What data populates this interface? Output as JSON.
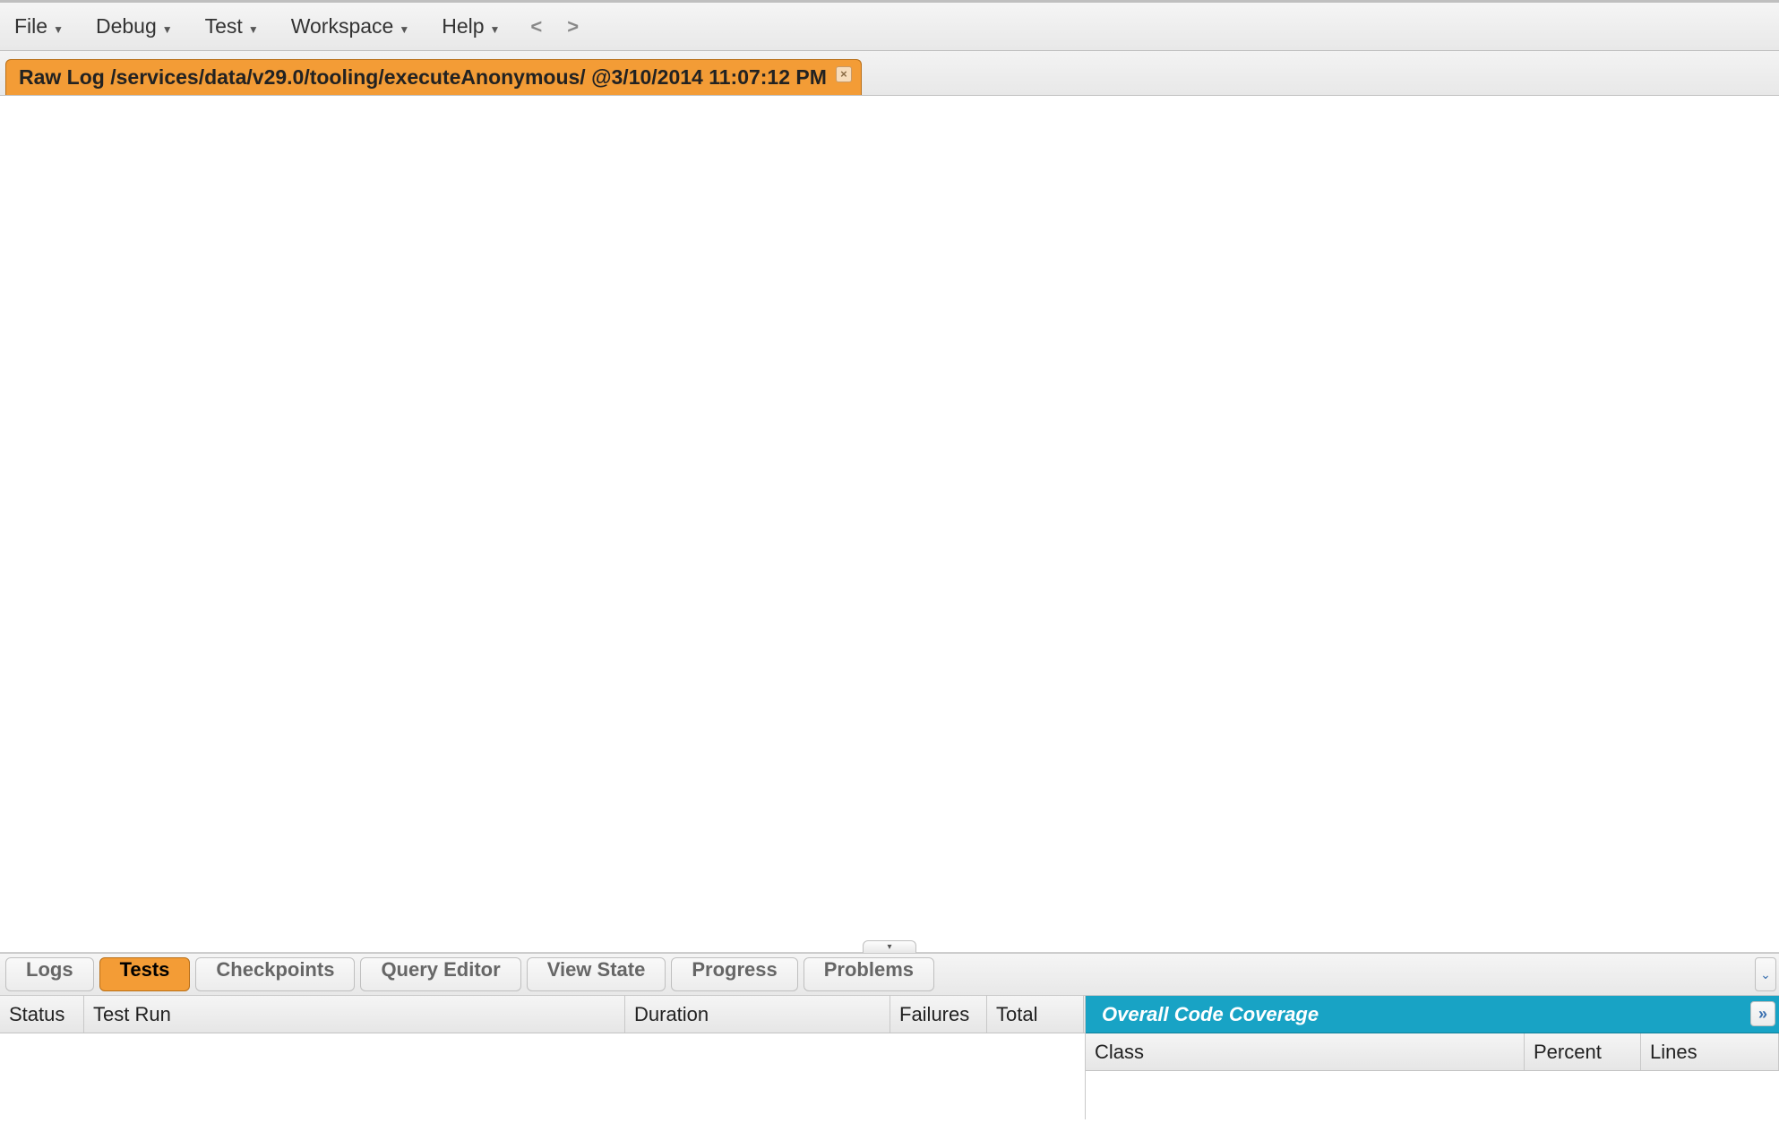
{
  "menu": {
    "items": [
      "File",
      "Debug",
      "Test",
      "Workspace",
      "Help"
    ]
  },
  "editor_tabs": [
    {
      "label": "Raw Log /services/data/v29.0/tooling/executeAnonymous/ @3/10/2014 11:07:12 PM"
    }
  ],
  "bottom_tabs": [
    {
      "label": "Logs",
      "active": false
    },
    {
      "label": "Tests",
      "active": true
    },
    {
      "label": "Checkpoints",
      "active": false
    },
    {
      "label": "Query Editor",
      "active": false
    },
    {
      "label": "View State",
      "active": false
    },
    {
      "label": "Progress",
      "active": false
    },
    {
      "label": "Problems",
      "active": false
    }
  ],
  "tests_grid": {
    "columns": {
      "status": "Status",
      "test_run": "Test Run",
      "duration": "Duration",
      "failures": "Failures",
      "total": "Total"
    }
  },
  "coverage": {
    "title": "Overall Code Coverage",
    "columns": {
      "class": "Class",
      "percent": "Percent",
      "lines": "Lines"
    }
  }
}
